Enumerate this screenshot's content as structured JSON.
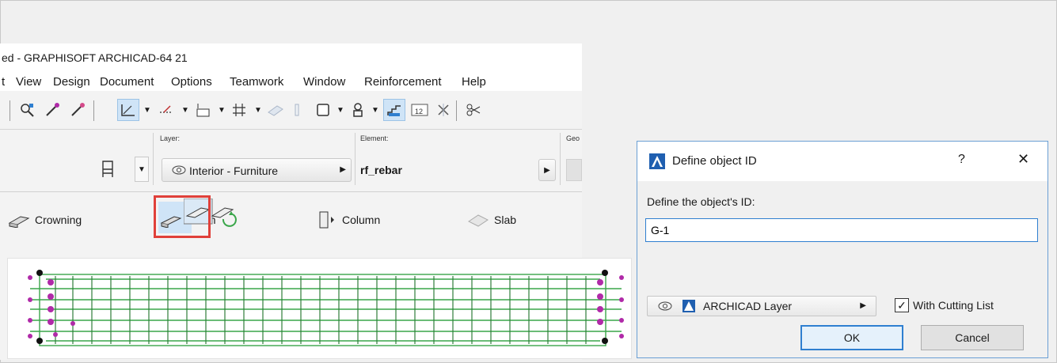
{
  "window": {
    "title": "ed - GRAPHISOFT ARCHICAD-64 21"
  },
  "menu": [
    "t",
    "View",
    "Design",
    "Document",
    "Options",
    "Teamwork",
    "Window",
    "Reinforcement",
    "Help"
  ],
  "infobox": {
    "layer_label": "Layer:",
    "layer_value": "Interior - Furniture",
    "element_label": "Element:",
    "element_value": "rf_rebar",
    "geo_label": "Geo"
  },
  "tools": {
    "crowning": "Crowning",
    "beam": "Beam",
    "column": "Column",
    "slab": "Slab"
  },
  "dialog": {
    "title": "Define object ID",
    "help": "?",
    "close": "✕",
    "prompt": "Define the object's ID:",
    "id_value": "G-1",
    "layer": "ARCHICAD Layer",
    "cutting_list_label": "With Cutting List",
    "cutting_list_checked": true,
    "ok_label": "OK",
    "cancel_label": "Cancel"
  },
  "colors": {
    "accent": "#2f7fd0",
    "highlight": "#e0403a",
    "rebar": "#3aa64a",
    "node": "#b02aa8"
  }
}
